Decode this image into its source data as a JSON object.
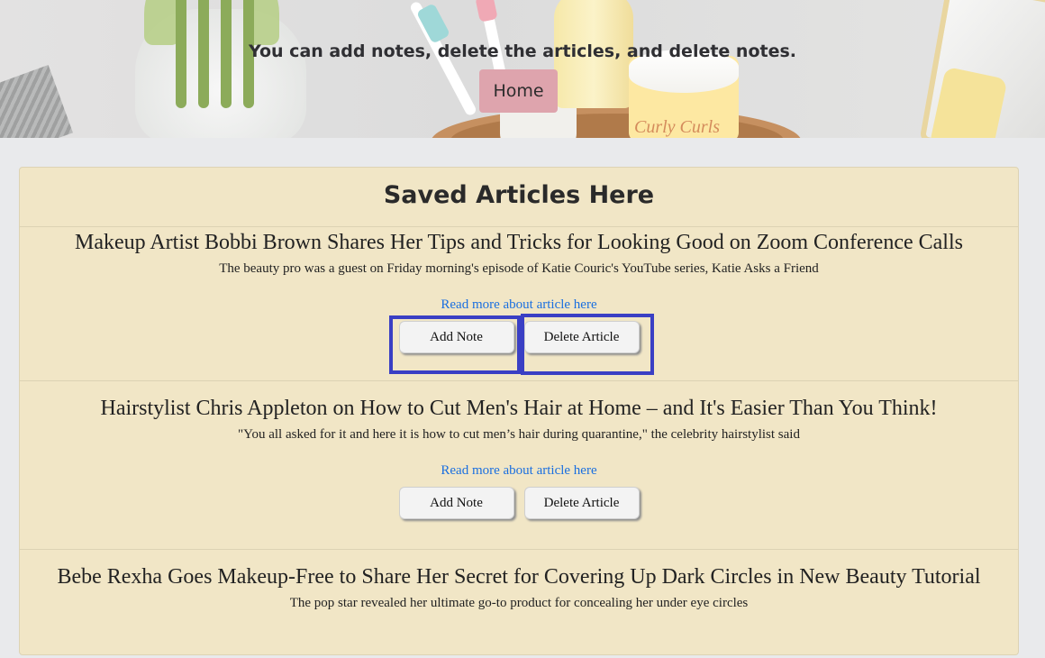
{
  "hero": {
    "message": "You can add notes, delete the articles, and delete notes.",
    "home_label": "Home",
    "jar_text": "Curly Curls"
  },
  "saved": {
    "heading": "Saved Articles Here",
    "articles": [
      {
        "title": "Makeup Artist Bobbi Brown Shares Her Tips and Tricks for Looking Good on Zoom Conference Calls",
        "summary": "The beauty pro was a guest on Friday morning's episode of Katie Couric's YouTube series, Katie Asks a Friend",
        "link_text": "Read more about article here",
        "add_note_label": "Add Note",
        "delete_label": "Delete Article"
      },
      {
        "title": "Hairstylist Chris Appleton on How to Cut Men's Hair at Home – and It's Easier Than You Think!",
        "summary": "\"You all asked for it and here it is how to cut men’s hair during quarantine,\" the celebrity hairstylist said",
        "link_text": "Read more about article here",
        "add_note_label": "Add Note",
        "delete_label": "Delete Article"
      },
      {
        "title": "Bebe Rexha Goes Makeup-Free to Share Her Secret for Covering Up Dark Circles in New Beauty Tutorial",
        "summary": "The pop star revealed her ultimate go-to product for concealing her under eye circles"
      }
    ]
  },
  "colors": {
    "home_button": "#dea4ad",
    "panel_background": "#f1e6c6",
    "link": "#1a6fe0",
    "highlight": "#3a3fc4"
  }
}
